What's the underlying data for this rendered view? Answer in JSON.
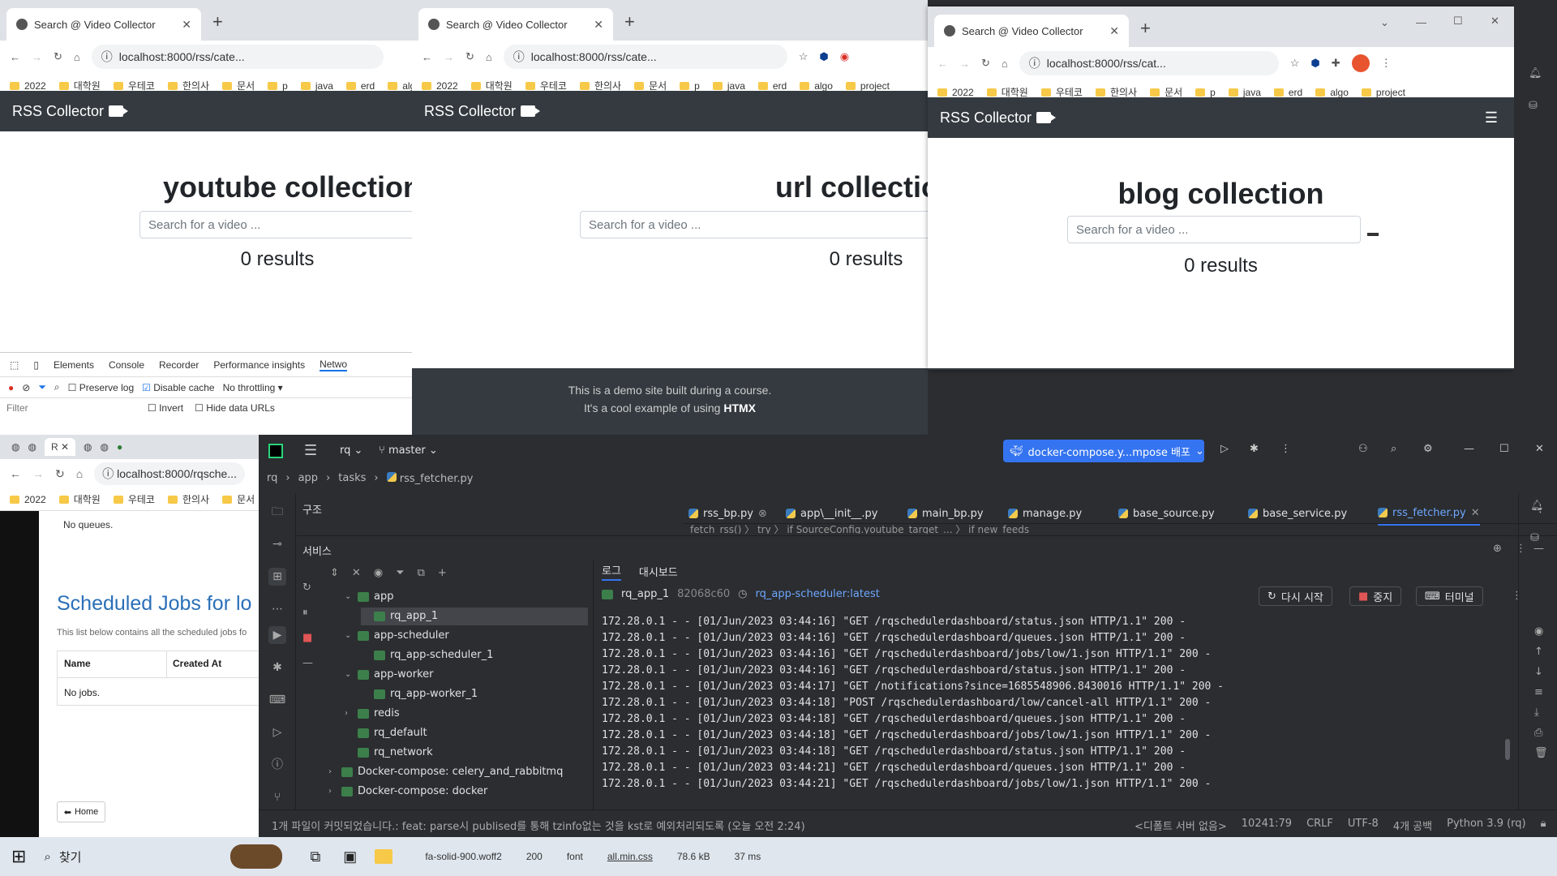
{
  "desktop_bg": "#2b2d30",
  "browser_tab_title": "Search @ Video Collector",
  "url_short": "localhost:8000/rss/cate...",
  "url_short3": "localhost:8000/rss/cat...",
  "url_rq": "localhost:8000/rqsche...",
  "bookmarks": [
    "2022",
    "대학원",
    "우테코",
    "한의사",
    "문서",
    "p",
    "java",
    "erd",
    "algo",
    "project"
  ],
  "brand": "RSS Collector",
  "search_placeholder": "Search for a video ...",
  "results_text": "0 results",
  "footer_line1": "This is a demo site built during a course.",
  "footer_line2": "It's a cool example of using",
  "footer_link": "HTMX",
  "win1": {
    "heading": "youtube collection"
  },
  "win2": {
    "heading": "url collection"
  },
  "win3": {
    "heading": "blog collection"
  },
  "devtools": {
    "tabs": [
      "Elements",
      "Console",
      "Recorder",
      "Performance insights",
      "Netwo"
    ],
    "preserve_log": "Preserve log",
    "disable_cache": "Disable cache",
    "throttling": "No throttling",
    "filter_placeholder": "Filter",
    "invert": "Invert",
    "hide_data_urls": "Hide data URLs"
  },
  "rq_page": {
    "no_queues": "No queues.",
    "title": "Scheduled Jobs for lo",
    "desc": "This list below contains all the scheduled jobs fo",
    "col_name": "Name",
    "col_created": "Created At",
    "no_jobs": "No jobs.",
    "home_btn": "Home"
  },
  "ide": {
    "project": "rq",
    "branch": "master",
    "run_config": "docker-compose.y...mpose 배포",
    "breadcrumbs": [
      "rq",
      "app",
      "tasks",
      "rss_fetcher.py"
    ],
    "structure_label": "구조",
    "services_label": "서비스",
    "editor_tabs": [
      "rss_bp.py",
      "app\\__init__.py",
      "main_bp.py",
      "manage.py",
      "base_source.py",
      "base_service.py",
      "rss_fetcher.py"
    ],
    "code_breadcrumb": "fetch_rss()  〉 try  〉 if SourceConfig.youtube_target_...  〉 if new_feeds",
    "log_tab": "로그",
    "dashboard_tab": "대시보드",
    "container": "rq_app_1",
    "container_id": "82068c60",
    "image": "rq_app-scheduler:latest",
    "restart_btn": "다시 시작",
    "stop_btn": "중지",
    "terminal_btn": "터미널",
    "tree": [
      {
        "label": "app",
        "level": 0,
        "expanded": true,
        "group": true
      },
      {
        "label": "rq_app_1",
        "level": 1,
        "selected": true
      },
      {
        "label": "app-scheduler",
        "level": 0,
        "expanded": true,
        "group": true
      },
      {
        "label": "rq_app-scheduler_1",
        "level": 1
      },
      {
        "label": "app-worker",
        "level": 0,
        "expanded": true,
        "group": true
      },
      {
        "label": "rq_app-worker_1",
        "level": 1
      },
      {
        "label": "redis",
        "level": 0,
        "expanded": false,
        "group": true
      },
      {
        "label": "rq_default",
        "level": 0
      },
      {
        "label": "rq_network",
        "level": 0
      },
      {
        "label": "Docker-compose: celery_and_rabbitmq",
        "level": -1,
        "expanded": false,
        "group": true
      },
      {
        "label": "Docker-compose: docker",
        "level": -1,
        "expanded": false,
        "group": true
      }
    ],
    "logs": [
      "172.28.0.1 - - [01/Jun/2023 03:44:16] \"GET /rqschedulerdashboard/status.json HTTP/1.1\" 200 -",
      "172.28.0.1 - - [01/Jun/2023 03:44:16] \"GET /rqschedulerdashboard/queues.json HTTP/1.1\" 200 -",
      "172.28.0.1 - - [01/Jun/2023 03:44:16] \"GET /rqschedulerdashboard/jobs/low/1.json HTTP/1.1\" 200 -",
      "172.28.0.1 - - [01/Jun/2023 03:44:16] \"GET /rqschedulerdashboard/status.json HTTP/1.1\" 200 -",
      "172.28.0.1 - - [01/Jun/2023 03:44:17] \"GET /notifications?since=1685548906.8430016 HTTP/1.1\" 200 -",
      "172.28.0.1 - - [01/Jun/2023 03:44:18] \"POST /rqschedulerdashboard/low/cancel-all HTTP/1.1\" 200 -",
      "172.28.0.1 - - [01/Jun/2023 03:44:18] \"GET /rqschedulerdashboard/queues.json HTTP/1.1\" 200 -",
      "172.28.0.1 - - [01/Jun/2023 03:44:18] \"GET /rqschedulerdashboard/jobs/low/1.json HTTP/1.1\" 200 -",
      "172.28.0.1 - - [01/Jun/2023 03:44:18] \"GET /rqschedulerdashboard/status.json HTTP/1.1\" 200 -",
      "172.28.0.1 - - [01/Jun/2023 03:44:21] \"GET /rqschedulerdashboard/queues.json HTTP/1.1\" 200 -",
      "172.28.0.1 - - [01/Jun/2023 03:44:21] \"GET /rqschedulerdashboard/jobs/low/1.json HTTP/1.1\" 200 -"
    ],
    "status_msg": "1개 파일이 커밋되었습니다.: feat: parse시 publised를 통해 tzinfo없는 것을 kst로 예외처리되도록 (오늘 오전 2:24)",
    "status_right": [
      "<디폴트 서버 없음>",
      "10241:79",
      "CRLF",
      "UTF-8",
      "4개 공백",
      "Python 3.9 (rq)"
    ]
  },
  "network_rows": [
    {
      "name": "fa-solid-900.woff2",
      "status": "200",
      "type": "font",
      "initiator": "all.min.css",
      "size": "78.6 kB",
      "time": "37 ms"
    }
  ],
  "taskbar_search": "찾기"
}
